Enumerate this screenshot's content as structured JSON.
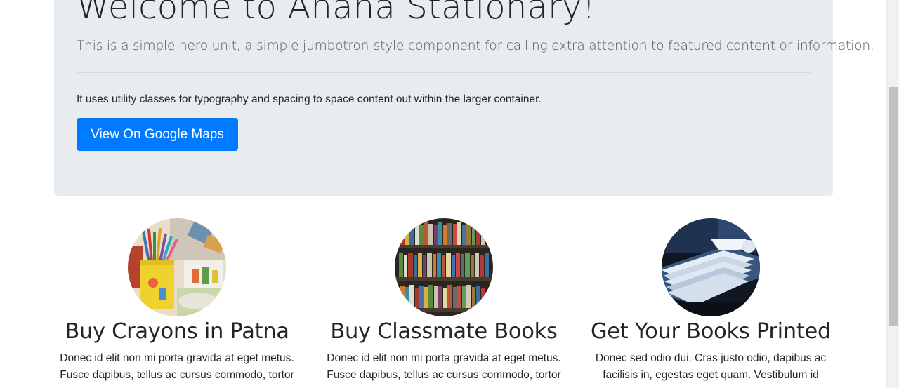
{
  "hero": {
    "title": "Welcome to Ahana Stationary!",
    "lead": "This is a simple hero unit, a simple jumbotron-style component for calling extra attention to featured content or information.",
    "text": "It uses utility classes for typography and spacing to space content out within the larger container.",
    "button_label": "View On Google Maps"
  },
  "features": [
    {
      "title": "Buy Crayons in Patna",
      "image_icon": "crayons-image",
      "lines": [
        "Donec id elit non mi porta gravida at eget metus.",
        "Fusce dapibus, tellus ac cursus commodo, tortor"
      ]
    },
    {
      "title": "Buy Classmate Books",
      "image_icon": "bookshelf-image",
      "lines": [
        "Donec id elit non mi porta gravida at eget metus.",
        "Fusce dapibus, tellus ac cursus commodo, tortor"
      ]
    },
    {
      "title": "Get Your Books Printed",
      "image_icon": "printed-books-image",
      "lines": [
        "Donec sed odio dui. Cras justo odio, dapibus ac",
        "facilisis in, egestas eget quam. Vestibulum id"
      ]
    }
  ],
  "colors": {
    "jumbotron_bg": "#e9ecef",
    "primary": "#007bff",
    "text": "#212529"
  }
}
